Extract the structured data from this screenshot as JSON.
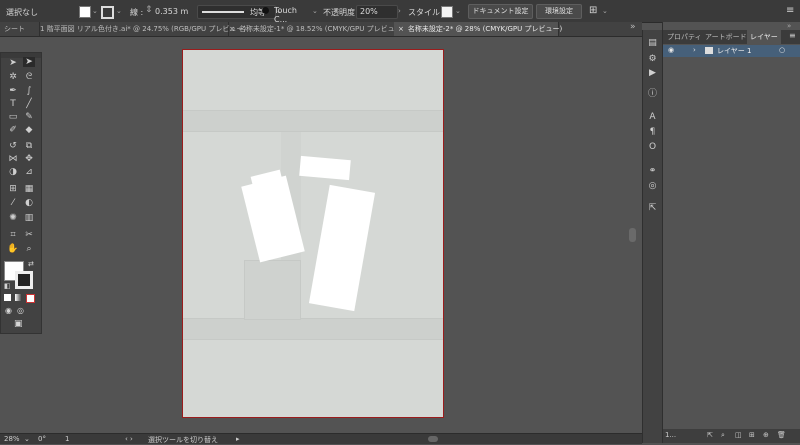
{
  "control_bar": {
    "selection_state": "選択なし",
    "stroke_label": "線 :",
    "stroke_weight": "0.353 m",
    "stroke_profile": "均等",
    "brush_name": "Touch C...",
    "opacity_label": "不透明度 :",
    "opacity_value": "20%",
    "style_label": "スタイル :",
    "document_setup_button": "ドキュメント設定",
    "preferences_button": "環境設定"
  },
  "tabs": [
    {
      "label": "シート"
    },
    {
      "label": "1 階平面図 リアル色付き.ai* @ 24.75% (RGB/GPU プレビュー)"
    },
    {
      "label": "名称未設定-1* @ 18.52% (CMYK/GPU プレビュー)"
    },
    {
      "label": "名称未設定-2* @ 28% (CMYK/GPU プレビュー)"
    }
  ],
  "panel": {
    "tabs": [
      "プロパティ",
      "アートボード",
      "レイヤー"
    ],
    "active_tab": "レイヤー",
    "layer_name": "レイヤー 1",
    "footer_count": "1..."
  },
  "status_bar": {
    "zoom": "28%",
    "rotation": "0°",
    "artboard_number": "1",
    "status_text": "選択ツールを切り替え"
  },
  "colors": {
    "ui_dark": "#3a3a3a",
    "canvas": "#535353",
    "artboard": "#d5d8d5",
    "artboard_border": "#9b1c1c",
    "selection": "#46607a"
  },
  "icons": {
    "toolbar": [
      "selection-tool",
      "direct-selection-tool",
      "magic-wand-tool",
      "lasso-tool",
      "pen-tool",
      "curvature-tool",
      "type-tool",
      "line-tool",
      "rectangle-tool",
      "paintbrush-tool",
      "shaper-tool",
      "eraser-tool",
      "rotate-tool",
      "scale-tool",
      "width-tool",
      "free-transform-tool",
      "shape-builder-tool",
      "perspective-tool",
      "mesh-tool",
      "gradient-tool",
      "eyedropper-tool",
      "blend-tool",
      "symbol-sprayer-tool",
      "graph-tool",
      "artboard-tool",
      "slice-tool",
      "hand-tool",
      "zoom-tool"
    ]
  }
}
